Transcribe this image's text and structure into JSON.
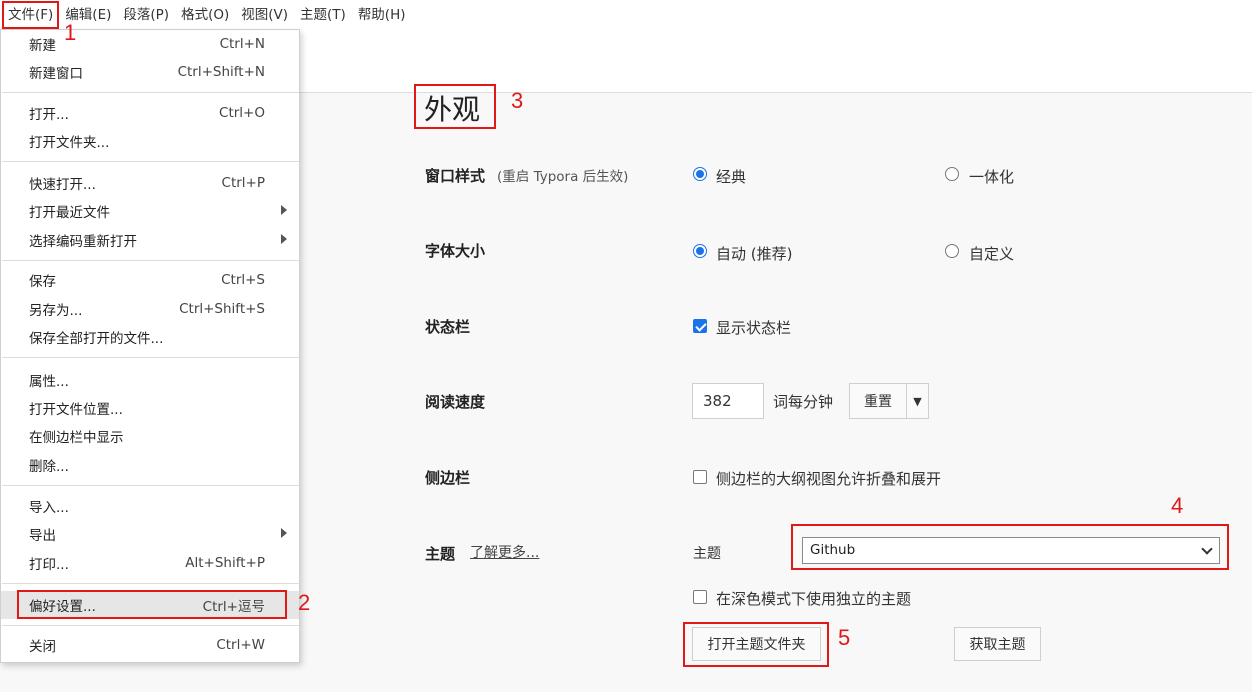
{
  "menubar": [
    {
      "label": "文件(F)"
    },
    {
      "label": "编辑(E)"
    },
    {
      "label": "段落(P)"
    },
    {
      "label": "格式(O)"
    },
    {
      "label": "视图(V)"
    },
    {
      "label": "主题(T)"
    },
    {
      "label": "帮助(H)"
    }
  ],
  "file_menu": [
    {
      "label": "新建",
      "shortcut": "Ctrl+N"
    },
    {
      "label": "新建窗口",
      "shortcut": "Ctrl+Shift+N"
    },
    {
      "label": "打开...",
      "shortcut": "Ctrl+O"
    },
    {
      "label": "打开文件夹...",
      "shortcut": ""
    },
    {
      "label": "快速打开...",
      "shortcut": "Ctrl+P"
    },
    {
      "label": "打开最近文件",
      "shortcut": ""
    },
    {
      "label": "选择编码重新打开",
      "shortcut": ""
    },
    {
      "label": "保存",
      "shortcut": "Ctrl+S"
    },
    {
      "label": "另存为...",
      "shortcut": "Ctrl+Shift+S"
    },
    {
      "label": "保存全部打开的文件...",
      "shortcut": ""
    },
    {
      "label": "属性...",
      "shortcut": ""
    },
    {
      "label": "打开文件位置...",
      "shortcut": ""
    },
    {
      "label": "在侧边栏中显示",
      "shortcut": ""
    },
    {
      "label": "删除...",
      "shortcut": ""
    },
    {
      "label": "导入...",
      "shortcut": ""
    },
    {
      "label": "导出",
      "shortcut": ""
    },
    {
      "label": "打印...",
      "shortcut": "Alt+Shift+P"
    },
    {
      "label": "偏好设置...",
      "shortcut": "Ctrl+逗号"
    },
    {
      "label": "关闭",
      "shortcut": "Ctrl+W"
    }
  ],
  "annotations": [
    "1",
    "2",
    "3",
    "4",
    "5"
  ],
  "prefs": {
    "title": "外观",
    "window_style": {
      "label": "窗口样式",
      "note": "(重启 Typora 后生效)",
      "opt1": "经典",
      "opt2": "一体化"
    },
    "font_size": {
      "label": "字体大小",
      "opt1": "自动 (推荐)",
      "opt2": "自定义"
    },
    "status_bar": {
      "label": "状态栏",
      "checkbox": "显示状态栏"
    },
    "reading_speed": {
      "label": "阅读速度",
      "value": "382",
      "unit": "词每分钟",
      "reset": "重置"
    },
    "sidebar": {
      "label": "侧边栏",
      "checkbox": "侧边栏的大纲视图允许折叠和展开"
    },
    "theme": {
      "label": "主题",
      "learn_more": "了解更多...",
      "field_label": "主题",
      "selected": "Github",
      "dark_checkbox": "在深色模式下使用独立的主题",
      "open_folder": "打开主题文件夹",
      "get_themes": "获取主题"
    }
  }
}
